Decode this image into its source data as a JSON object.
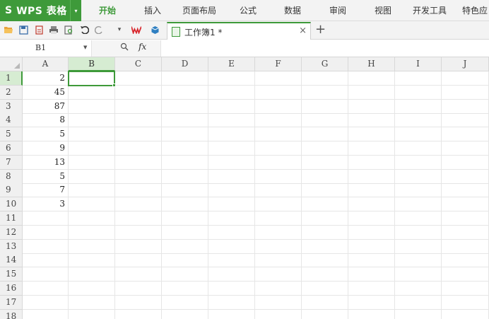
{
  "app": {
    "logo": "S",
    "title": "WPS 表格",
    "dropdown": "▾"
  },
  "menu": {
    "items": [
      "开始",
      "插入",
      "页面布局",
      "公式",
      "数据",
      "审阅",
      "视图",
      "开发工具",
      "特色应"
    ],
    "active_index": 0
  },
  "toolbar": {
    "icons": [
      "open-folder-icon",
      "save-icon",
      "export-icon",
      "print-icon",
      "print-preview-icon",
      "undo-icon",
      "redo-icon",
      "customize-dropdown-icon",
      "wps-logo-icon",
      "cube-icon"
    ]
  },
  "document_tab": {
    "title": "工作簿1 *",
    "close": "×",
    "new_tab": "+"
  },
  "formula_bar": {
    "name_box": "B1",
    "zoom_symbol": "🔍",
    "fx": "fx",
    "formula": ""
  },
  "sheet": {
    "columns": [
      "A",
      "B",
      "C",
      "D",
      "E",
      "F",
      "G",
      "H",
      "I",
      "J"
    ],
    "rows": [
      "1",
      "2",
      "3",
      "4",
      "5",
      "6",
      "7",
      "8",
      "9",
      "10",
      "11",
      "12",
      "13",
      "14",
      "15",
      "16",
      "17",
      "18"
    ],
    "selected_cell": "B1",
    "column_a_values": [
      "2",
      "45",
      "87",
      "8",
      "5",
      "9",
      "13",
      "5",
      "7",
      "3"
    ]
  },
  "colors": {
    "accent": "#3e9a3a",
    "header_bg": "#f0f0f0",
    "selection_bg": "#d6ecd2"
  }
}
